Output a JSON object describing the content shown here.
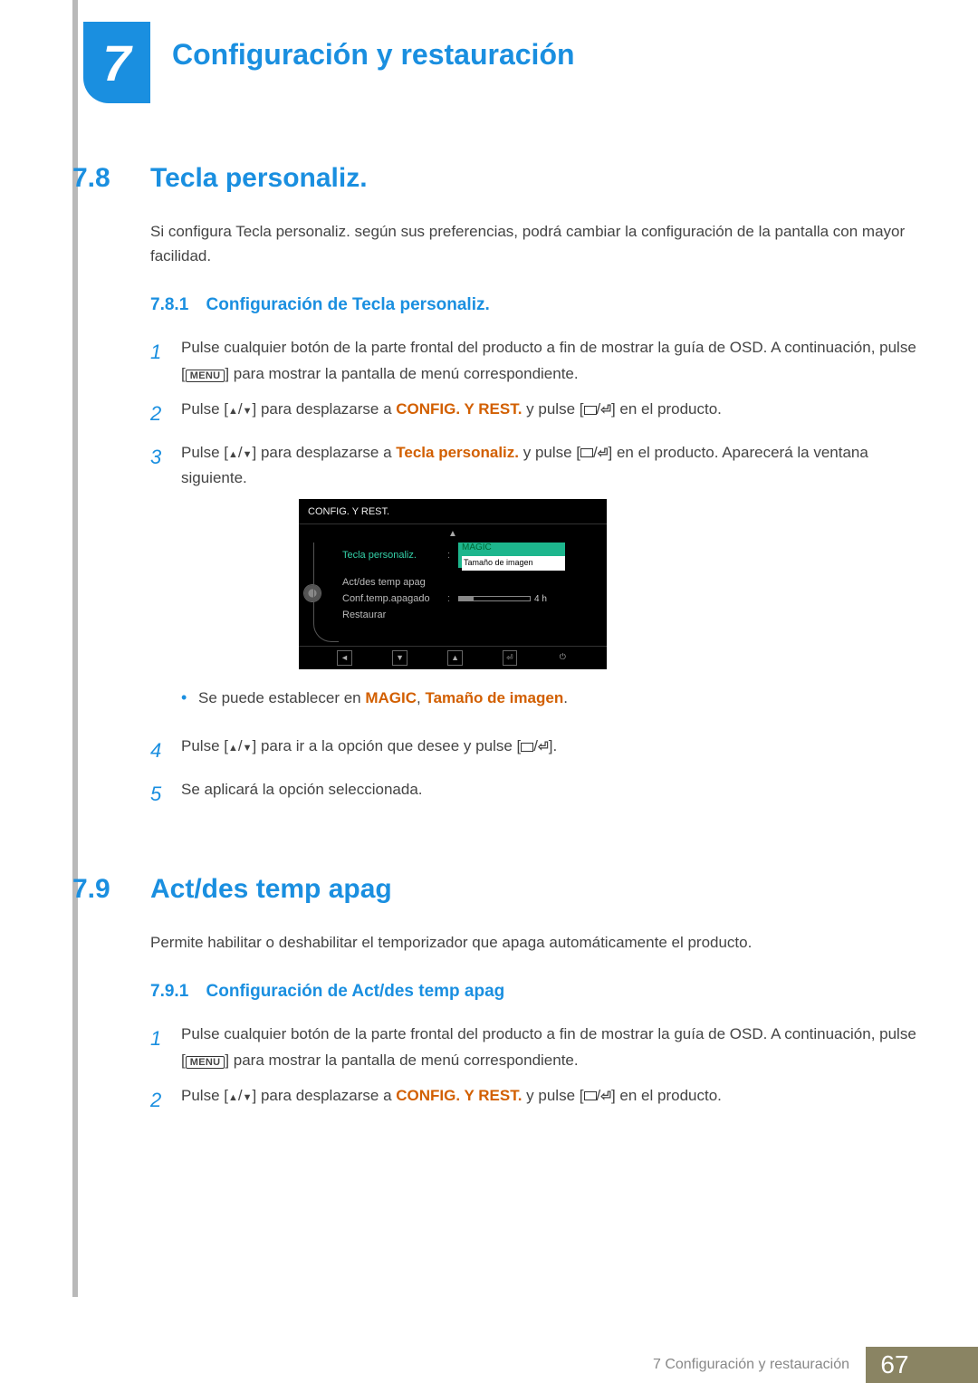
{
  "chapter": {
    "num": "7",
    "title": "Configuración y restauración"
  },
  "s78": {
    "num": "7.8",
    "title": "Tecla personaliz.",
    "intro": "Si configura Tecla personaliz. según sus preferencias, podrá cambiar la configuración de la pantalla con mayor facilidad.",
    "sub_num": "7.8.1",
    "sub_title": "Configuración de Tecla personaliz.",
    "step1a": "Pulse cualquier botón de la parte frontal del producto a fin de mostrar la guía de OSD. A continuación, pulse [",
    "menu": "MENU",
    "step1b": "] para mostrar la pantalla de menú correspondiente.",
    "step2a": "Pulse [",
    "step2b": "] para desplazarse a ",
    "cf_rest": "CONFIG. Y REST.",
    "step2c": " y pulse [",
    "step2d": "] en el producto.",
    "step3a": "Pulse [",
    "step3b": "] para desplazarse a ",
    "tp": "Tecla personaliz.",
    "step3c": " y pulse [",
    "step3d": "] en el producto. Aparecerá la ventana siguiente.",
    "bullet_a": "Se puede establecer en ",
    "magic": "MAGIC",
    "bullet_b": ", ",
    "tam": "Tamaño de imagen",
    "bullet_c": ".",
    "step4a": "Pulse [",
    "step4b": "] para ir a la opción que desee y pulse [",
    "step4c": "].",
    "step5": "Se aplicará la opción seleccionada."
  },
  "osd": {
    "title": "CONFIG. Y REST.",
    "items": [
      "Tecla personaliz.",
      "Act/des temp apag",
      "Conf.temp.apagado",
      "Restaurar"
    ],
    "box_top": "MAGIC",
    "box_sel": "Tamaño de imagen",
    "slider_txt": "4 h"
  },
  "s79": {
    "num": "7.9",
    "title": "Act/des temp apag",
    "intro": "Permite habilitar o deshabilitar el temporizador que apaga automáticamente el producto.",
    "sub_num": "7.9.1",
    "sub_title": "Configuración de Act/des temp apag",
    "step1a": "Pulse cualquier botón de la parte frontal del producto a fin de mostrar la guía de OSD. A continuación, pulse [",
    "menu": "MENU",
    "step1b": "] para mostrar la pantalla de menú correspondiente.",
    "step2a": "Pulse [",
    "step2b": "] para desplazarse a ",
    "cf_rest": "CONFIG. Y REST.",
    "step2c": " y pulse [",
    "step2d": "] en el producto."
  },
  "footer": {
    "chapter_label": "7 Configuración y restauración",
    "page": "67"
  },
  "nums": {
    "n1": "1",
    "n2": "2",
    "n3": "3",
    "n4": "4",
    "n5": "5"
  }
}
